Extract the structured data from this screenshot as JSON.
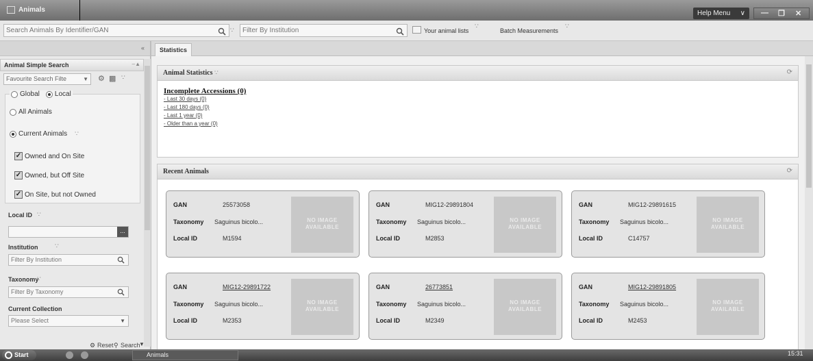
{
  "window": {
    "title": "Animals"
  },
  "help_menu": {
    "label": "Help Menu",
    "chevron": "∨"
  },
  "window_controls": [
    "minimize-icon",
    "restore-icon",
    "close-icon"
  ],
  "toolbar": {
    "search_placeholder": "Search Animals By Identifier/GAN",
    "filter_placeholder": "Filter By Institution",
    "your_animal_lists": "Your animal lists",
    "batch_measurements": "Batch Measurements"
  },
  "sidebar": {
    "collapse": "«",
    "header_title": "Animal Simple Search",
    "favourite_placeholder": "Favourite Search Filte",
    "scope": {
      "global": "Global",
      "local": "Local",
      "selected": "Local"
    },
    "all_animals": "All Animals",
    "current_animals": "Current Animals",
    "animal_selection": "Current Animals",
    "checks": [
      {
        "label": "Owned and On Site",
        "checked": true
      },
      {
        "label": "Owned, but Off Site",
        "checked": true
      },
      {
        "label": "On Site, but not Owned",
        "checked": true
      }
    ],
    "local_id_label": "Local ID",
    "local_id_button": "...",
    "institution_label": "Institution",
    "institution_placeholder": "Filter By Institution",
    "taxonomy_label": "Taxonomy",
    "taxonomy_placeholder": "Filter By Taxonomy",
    "collection_label": "Current Collection",
    "collection_value": "Please Select",
    "reset_label": "Reset",
    "search_label": "Search"
  },
  "tabs": [
    {
      "label": "Statistics",
      "active": true
    }
  ],
  "statistics": {
    "title": "Animal Statistics",
    "incomplete_title": "Incomplete Accessions (0)",
    "links": [
      "- Last 30 days (0)",
      "- Last 180 days (0)",
      "- Last 1 year (0)",
      "- Older than a year (0)"
    ]
  },
  "recent": {
    "title": "Recent Animals",
    "labels": {
      "gan": "GAN",
      "taxonomy": "Taxonomy",
      "local_id": "Local ID"
    },
    "no_image": "NO IMAGE AVAILABLE",
    "cards": [
      {
        "gan": "25573058",
        "taxonomy": "Saguinus bicolo...",
        "local_id": "M1594"
      },
      {
        "gan": "MIG12-29891804",
        "taxonomy": "Saguinus bicolo...",
        "local_id": "M2853"
      },
      {
        "gan": "MIG12-29891615",
        "taxonomy": "Saguinus bicolo...",
        "local_id": "C14757"
      },
      {
        "gan": "MIG12-29891722",
        "taxonomy": "Saguinus bicolo...",
        "local_id": "M2353"
      },
      {
        "gan": "26773851",
        "taxonomy": "Saguinus bicolo...",
        "local_id": "M2349"
      },
      {
        "gan": "MIG12-29891805",
        "taxonomy": "Saguinus bicolo...",
        "local_id": "M2453"
      }
    ]
  },
  "taskbar": {
    "start": "Start",
    "task": "Animals",
    "clock": "15:31"
  }
}
